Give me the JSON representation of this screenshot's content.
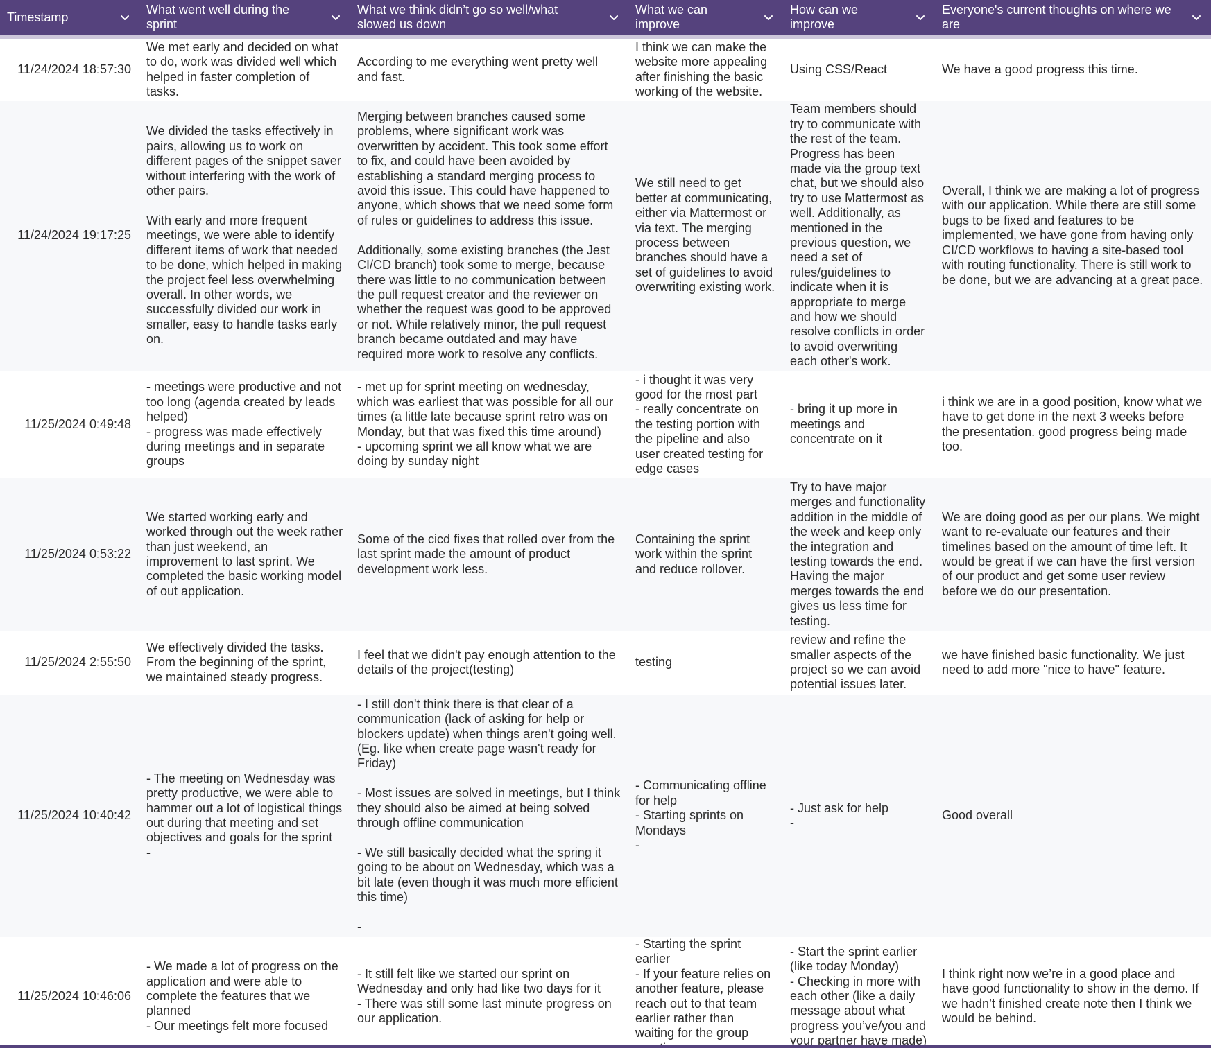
{
  "colors": {
    "header_bg": "#55427d",
    "header_text": "#ffffff",
    "row_alt_bg": "#f7f8fa"
  },
  "columns": [
    {
      "label": "Timestamp",
      "icon": "chevron-down-icon"
    },
    {
      "label": "What went well during the sprint",
      "icon": "chevron-down-icon"
    },
    {
      "label": "What we think didn’t go so well/what slowed us down",
      "icon": "chevron-down-icon"
    },
    {
      "label": "What we can improve",
      "icon": "chevron-down-icon"
    },
    {
      "label": "How can we improve",
      "icon": "chevron-down-icon"
    },
    {
      "label": "Everyone's current thoughts on where we are",
      "icon": "chevron-down-icon"
    }
  ],
  "rows": [
    {
      "timestamp": "11/24/2024 18:57:30",
      "went_well": "We met early and decided on what to do, work was divided well which helped in faster completion of tasks.",
      "didnt_go_well": "According to me everything went pretty well and fast.",
      "can_improve": "I think we can make the website more appealing after finishing the basic working of the website.",
      "how_improve": "Using CSS/React",
      "thoughts": "We have a good progress this time."
    },
    {
      "timestamp": "11/24/2024 19:17:25",
      "went_well": "We divided the tasks effectively in pairs, allowing us to work on different pages of the snippet saver without interfering with the work of other pairs.\n\nWith early and more frequent meetings, we were able to identify different items of work that needed to be done, which helped in making the project feel less overwhelming overall. In other words, we successfully divided our work in smaller, easy to handle tasks early on.",
      "didnt_go_well": "Merging between branches caused some problems, where significant work was overwritten by accident. This took some effort to fix, and could have been avoided by establishing a standard merging process to avoid this issue. This could have happened to anyone, which shows that we need some form of rules or guidelines to address this issue.\n\nAdditionally, some existing branches (the Jest CI/CD branch) took some to merge, because there was little to no communication between the pull request creator and the reviewer on whether the request was good to be approved or not. While relatively minor, the pull request branch became outdated and may have required more work to resolve any conflicts.",
      "can_improve": "We still need to get better at communicating, either via Mattermost or via text. The merging process between branches should have a set of guidelines to avoid overwriting existing work.",
      "how_improve": "Team members should try to communicate with the rest of the team. Progress has been made via the group text chat, but we should also try to use Mattermost as well. Additionally, as mentioned in the previous question, we need a set of rules/guidelines to indicate when it is appropriate to merge and how we should resolve conflicts in order to avoid overwriting each other's work.",
      "thoughts": "Overall, I think we are making a lot of progress with our application. While there are still some bugs to be fixed and features to be implemented, we have gone from having only CI/CD workflows to having a site-based tool with routing functionality. There is still work to be done, but we are advancing at a great pace."
    },
    {
      "timestamp": "11/25/2024 0:49:48",
      "went_well": "- meetings were productive and not too long (agenda created by leads helped)\n- progress was made effectively during meetings and in separate groups",
      "didnt_go_well": "- met up for sprint meeting on wednesday, which was earliest that was possible for all our times (a little late because sprint retro was on Monday, but that was fixed this time around)\n- upcoming sprint we all know what we are doing by sunday night",
      "can_improve": "- i thought it was very good for the most part\n- really concentrate on the testing portion with the pipeline and also user created testing for edge cases",
      "how_improve": "- bring it up more in meetings and concentrate on it",
      "thoughts": "i think we are in a good position, know what we have to get done in the next 3 weeks before the presentation. good progress being made too."
    },
    {
      "timestamp": "11/25/2024 0:53:22",
      "went_well": "We started working early and worked through out the week rather than just weekend, an improvement to last sprint. We completed the basic working model of out application.",
      "didnt_go_well": "Some of the cicd fixes that rolled over from the last sprint made the amount of product development work less.",
      "can_improve": "Containing the sprint work within the sprint and reduce rollover.",
      "how_improve": "Try to have major merges and functionality addition in the middle of the week and keep only the integration and testing towards the end. Having the major merges towards the end gives us less time for testing.",
      "thoughts": "We are doing good as per our plans. We might want to re-evaluate our features and their timelines based on the amount of time left. It would be great if we can have the first version of our product and get some user review before we do our presentation."
    },
    {
      "timestamp": "11/25/2024 2:55:50",
      "went_well": "We effectively divided the tasks. From the beginning of the sprint, we maintained steady progress.",
      "didnt_go_well": "I feel that we didn't pay enough attention to the details of the project(testing)",
      "can_improve": "testing",
      "how_improve": "review and refine the smaller aspects of the project so we can avoid potential issues later.",
      "thoughts": "we have finished basic functionality. We just need to add more \"nice to have\" feature."
    },
    {
      "timestamp": "11/25/2024 10:40:42",
      "went_well": "- The meeting on Wednesday was pretty productive, we were able to hammer out a lot of logistical things out during that meeting and set objectives and goals for the sprint\n-",
      "didnt_go_well": "- I still don't think there is that clear of a communication (lack of asking for help or blockers update) when things aren't going well. (Eg. like when create page wasn't ready for Friday)\n\n- Most issues are solved in meetings, but I think they should also be aimed at being solved through offline communication\n\n- We still basically decided what the spring it going to be about on Wednesday, which was a bit late (even though it was much more efficient this time)\n\n-",
      "can_improve": "- Communicating offline for help\n- Starting sprints on Mondays\n-",
      "how_improve": "- Just ask for help\n-",
      "thoughts": "Good overall"
    },
    {
      "timestamp": "11/25/2024 10:46:06",
      "went_well": "- We made a lot of progress on the application and were able to complete the features that we planned\n- Our meetings felt more focused",
      "didnt_go_well": "- It still felt like we started our sprint on Wednesday and only had like two days for it\n- There was still some last minute progress on our application.",
      "can_improve": "- Starting the sprint earlier\n- If your feature relies on another feature, please reach out to that team earlier rather than waiting for the group meeting",
      "how_improve": "- Start the sprint earlier (like today Monday)\n- Checking in more with each other (like a daily message about what progress you’ve/you and your partner have made)",
      "thoughts": "I think right now we’re in a good place and have good functionality to show in the demo. If we hadn’t finished create note then I think we would be behind."
    }
  ]
}
